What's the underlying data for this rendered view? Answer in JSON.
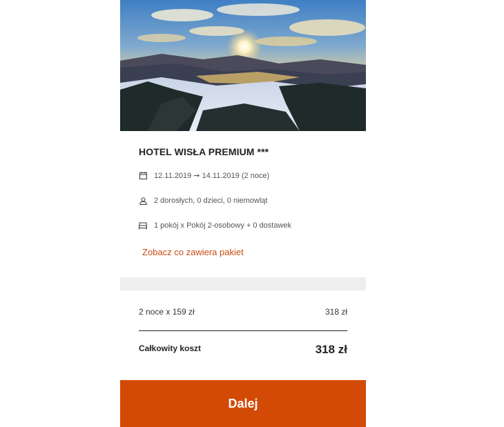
{
  "hotel": {
    "name": "HOTEL WISŁA PREMIUM ***"
  },
  "stay": {
    "dates": "12.11.2019 ➞ 14.11.2019 (2 noce)",
    "guests": "2 dorosłych, 0 dzieci, 0 niemowląt",
    "room": "1 pokój x Pokój 2-osobowy + 0 dostawek"
  },
  "package_link": "Zobacz co zawiera pakiet",
  "pricing": {
    "line_label": "2 noce x 159 zł",
    "line_value": "318 zł",
    "total_label": "Całkowity koszt",
    "total_value": "318 zł"
  },
  "button": {
    "label": "Dalej"
  },
  "icons": {
    "dates": "calendar-icon",
    "guests": "person-icon",
    "room": "bed-icon"
  },
  "colors": {
    "accent": "#d34a06",
    "link": "#c94a12",
    "divider": "#eeeeee"
  }
}
